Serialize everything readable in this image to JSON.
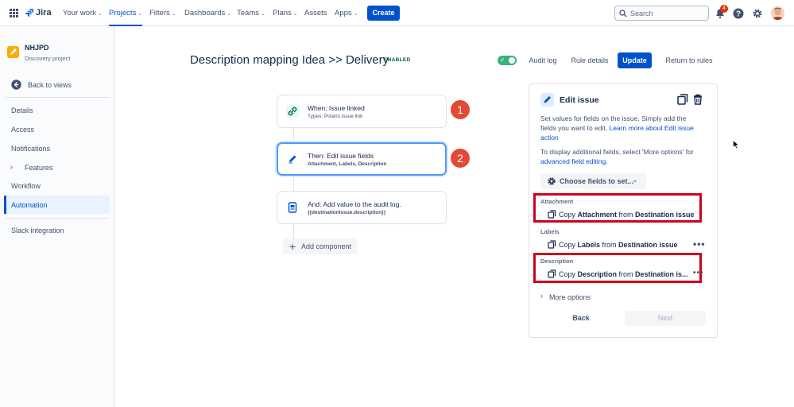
{
  "nav": {
    "brand": "Jira",
    "items": [
      {
        "label": "Your work",
        "chev": true
      },
      {
        "label": "Projects",
        "chev": true
      },
      {
        "label": "Filters",
        "chev": true
      },
      {
        "label": "Dashboards",
        "chev": true
      },
      {
        "label": "Teams",
        "chev": true
      },
      {
        "label": "Plans",
        "chev": true
      },
      {
        "label": "Assets",
        "chev": false
      },
      {
        "label": "Apps",
        "chev": true
      }
    ],
    "create": "Create",
    "search_placeholder": "Search",
    "notif_count": "4"
  },
  "sidebar": {
    "project_name": "NHJPD",
    "project_type": "Discovery project",
    "back": "Back to views",
    "items": [
      "Details",
      "Access",
      "Notifications",
      "Features",
      "Workflow",
      "Automation"
    ],
    "slack": "Slack integration"
  },
  "header": {
    "title": "Description mapping Idea >> Delivery",
    "status": "ENABLED",
    "audit_log": "Audit log",
    "rule_details": "Rule details",
    "update": "Update",
    "return": "Return to rules"
  },
  "flow": {
    "trigger_title": "When: Issue linked",
    "trigger_sub": "Types: Polaris issue link",
    "action_title": "Then: Edit issue fields",
    "action_sub": "Attachment, Labels, Description",
    "and_title": "And: Add value to the audit log.",
    "and_sub": "{{destinationIssue.description}}",
    "step1": "1",
    "step2": "2",
    "add_component": "Add component"
  },
  "panel": {
    "title": "Edit issue",
    "p1a": "Set values for fields on the issue. Simply add the",
    "p1b": "fields you want to edit. ",
    "p1link": "Learn more about Edit issue",
    "p1c": "action",
    "p2a": "To display additional fields, select 'More options' for",
    "p2link": "advanced field editing.",
    "choose": "Choose fields to set...",
    "fields": [
      {
        "label": "Attachment",
        "copy": "Copy ",
        "field": "Attachment",
        "from": " from ",
        "src": "Destination issue"
      },
      {
        "label": "Labels",
        "copy": "Copy ",
        "field": "Labels",
        "from": " from ",
        "src": "Destination issue"
      },
      {
        "label": "Description",
        "copy": "Copy ",
        "field": "Description",
        "from": " from ",
        "src": "Destination is..."
      }
    ],
    "more_options": "More options",
    "back": "Back",
    "next": "Next"
  },
  "colors": {
    "accent": "#0052cc",
    "highlight": "#d0021b",
    "enabled": "#006644"
  }
}
